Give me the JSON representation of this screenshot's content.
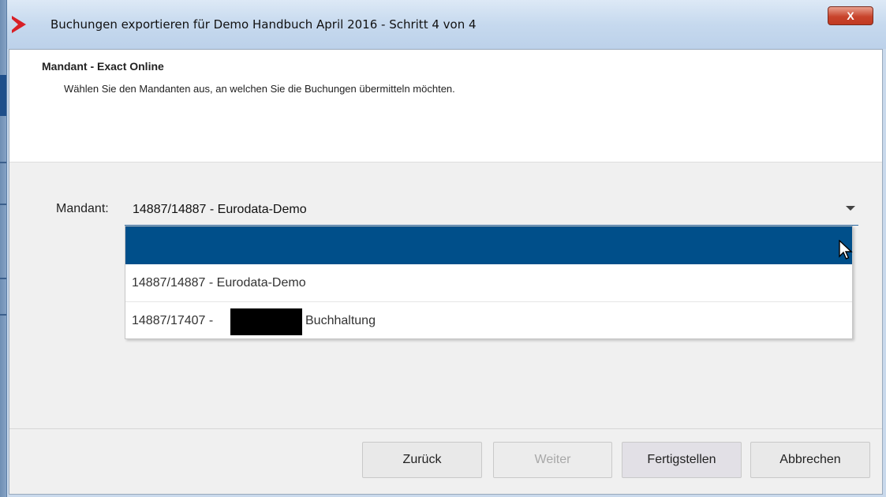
{
  "window": {
    "title": "Buchungen exportieren für Demo Handbuch April 2016 - Schritt 4 von 4",
    "close_label": "X"
  },
  "header": {
    "title": "Mandant - Exact Online",
    "description": "Wählen Sie den Mandanten aus, an welchen Sie die Buchungen übermitteln möchten."
  },
  "form": {
    "mandant_label": "Mandant:",
    "selected_value": "14887/14887 - Eurodata-Demo",
    "options": [
      "",
      "14887/14887 - Eurodata-Demo",
      "14887/17407 -",
      "Buchhaltung"
    ]
  },
  "buttons": {
    "back": "Zurück",
    "next": "Weiter",
    "finish": "Fertigstellen",
    "cancel": "Abbrechen"
  },
  "colors": {
    "selection": "#004f8a",
    "close_button": "#c8442c"
  }
}
